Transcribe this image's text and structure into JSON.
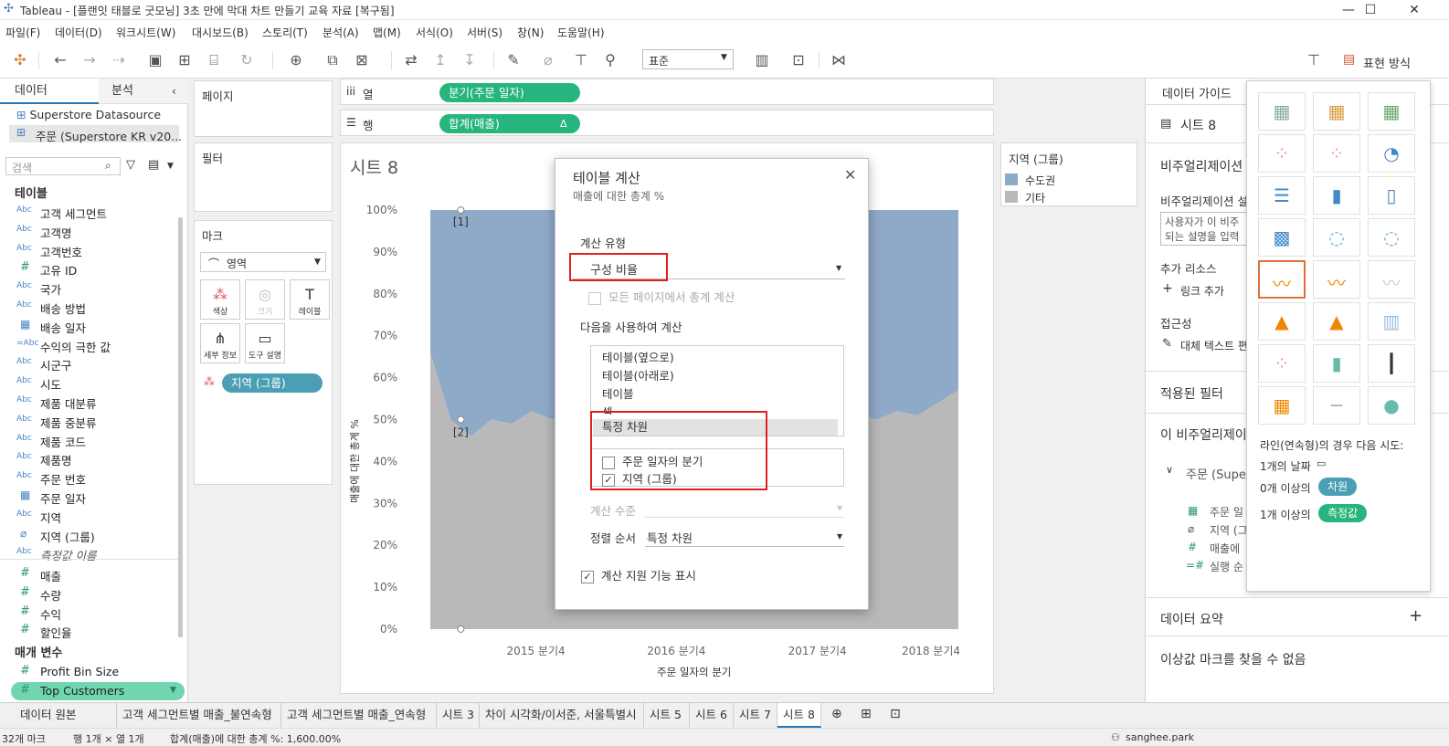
{
  "window": {
    "title": "Tableau - [플랜잇 태블로 굿모닝] 3초 만에 막대 차트 만들기 교육 자료 [복구됨]",
    "controls": [
      "—",
      "☐",
      "✕"
    ]
  },
  "menu": [
    "파일(F)",
    "데이터(D)",
    "워크시트(W)",
    "대시보드(B)",
    "스토리(T)",
    "분석(A)",
    "맵(M)",
    "서식(O)",
    "서버(S)",
    "창(N)",
    "도움말(H)"
  ],
  "toolbar": {
    "fit_select": "표준",
    "show_me_label": "표현 방식"
  },
  "left_pane": {
    "tab_data": "데이터",
    "tab_analysis": "분석",
    "datasources": [
      "Superstore Datasource",
      "주문 (Superstore KR v20..."
    ],
    "search_placeholder": "검색",
    "tables_header": "테이블",
    "fields": [
      {
        "type": "Abc",
        "name": "고객 세그먼트"
      },
      {
        "type": "Abc",
        "name": "고객명"
      },
      {
        "type": "Abc",
        "name": "고객번호"
      },
      {
        "type": "#",
        "name": "고유 ID"
      },
      {
        "type": "Abc",
        "name": "국가"
      },
      {
        "type": "Abc",
        "name": "배송 방법"
      },
      {
        "type": "date",
        "name": "배송 일자"
      },
      {
        "type": "=Abc",
        "name": "수익의 극한 값"
      },
      {
        "type": "Abc",
        "name": "시군구"
      },
      {
        "type": "Abc",
        "name": "시도"
      },
      {
        "type": "Abc",
        "name": "제품 대분류"
      },
      {
        "type": "Abc",
        "name": "제품 중분류"
      },
      {
        "type": "Abc",
        "name": "제품 코드"
      },
      {
        "type": "Abc",
        "name": "제품명"
      },
      {
        "type": "Abc",
        "name": "주문 번호"
      },
      {
        "type": "date",
        "name": "주문 일자"
      },
      {
        "type": "Abc",
        "name": "지역"
      },
      {
        "type": "clip",
        "name": "지역 (그룹)"
      },
      {
        "type": "Abc",
        "name": "측정값 이름"
      }
    ],
    "measures": [
      "매출",
      "수량",
      "수익",
      "할인율"
    ],
    "params_header": "매개 변수",
    "params": [
      "Profit Bin Size",
      "Top Customers"
    ]
  },
  "shelves": {
    "pages": "페이지",
    "columns_label": "열",
    "rows_label": "행",
    "columns_pill": "분기(주문 일자)",
    "rows_pill": "합계(매출)",
    "filters": "필터",
    "marks": "마크",
    "mark_type": "영역",
    "mark_buttons": [
      "색상",
      "크기",
      "레이블",
      "세부 정보",
      "도구 설명"
    ],
    "color_pill": "지역 (그룹)"
  },
  "sheet": {
    "title": "시트 8",
    "y_axis_label": "매출에 대한 총계 %",
    "x_axis_label": "주문 일자의 분기",
    "annotations": [
      "[1]",
      "[2]"
    ]
  },
  "chart_data": {
    "type": "area",
    "x_tick_labels": [
      "2015 분기4",
      "2016 분기4",
      "2017 분기4",
      "2018 분기4"
    ],
    "y_tick_labels": [
      "100%",
      "90%",
      "80%",
      "70%",
      "60%",
      "50%",
      "40%",
      "30%",
      "20%",
      "10%",
      "0%"
    ],
    "ylim": [
      0,
      100
    ],
    "series": [
      {
        "name": "기타",
        "color": "#b9b9b9",
        "values": [
          66,
          50,
          46,
          50,
          49,
          52,
          50,
          52,
          50,
          50,
          50,
          51,
          48,
          50,
          51,
          53,
          49,
          52,
          50,
          52,
          49,
          51,
          50,
          52,
          51,
          54,
          57
        ]
      },
      {
        "name": "수도권",
        "color": "#8fa9c8",
        "values": [
          34,
          50,
          54,
          50,
          51,
          48,
          50,
          48,
          50,
          50,
          50,
          49,
          52,
          50,
          49,
          47,
          51,
          48,
          50,
          48,
          51,
          49,
          50,
          48,
          49,
          46,
          43
        ]
      }
    ]
  },
  "legend": {
    "title": "지역 (그룹)",
    "items": [
      {
        "name": "수도권",
        "color": "#8fa9c8"
      },
      {
        "name": "기타",
        "color": "#b9b9b9"
      }
    ]
  },
  "dialog": {
    "title": "테이블 계산",
    "subtitle": "매출에 대한 총계 %",
    "calc_type_label": "계산 유형",
    "calc_type_value": "구성 비율",
    "all_pages_label": "모든 페이지에서 총계 계산",
    "compute_using_label": "다음을 사용하여 계산",
    "compute_options": [
      "테이블(옆으로)",
      "테이블(아래로)",
      "테이블",
      "셀",
      "특정 차원"
    ],
    "dimensions": [
      {
        "label": "주문 일자의 분기",
        "checked": false
      },
      {
        "label": "지역 (그룹)",
        "checked": true
      }
    ],
    "level_label": "계산 수준",
    "sort_label": "정렬 순서",
    "sort_value": "특정 차원",
    "assist_label": "계산 지원 기능 표시"
  },
  "guide": {
    "title": "데이터 가이드",
    "sheet": "시트 8",
    "viz_desc_header": "비주얼리제이션",
    "viz_desc_sub": "비주얼리제이션 설",
    "desc_placeholder": "사용자가 이 비주\n되는 설명을 입력",
    "resources": "추가 리소스",
    "add_link": "링크 추가",
    "accessibility": "접근성",
    "alt_text": "대체 텍스트 편",
    "applied_filters": "적용된 필터",
    "this_viz": "이 비주얼리제이",
    "source_item": "주문 (Supe",
    "fields": [
      "주문 일",
      "지역 (그",
      "매출에",
      "실행 순"
    ],
    "data_summary": "데이터 요약",
    "no_outliers": "이상값 마크를 찾을 수 없음"
  },
  "showme": {
    "hint_title": "라인(연속형)의 경우 다음 시도:",
    "hint1": "1개의 날짜",
    "hint2_pre": "0개 이상의",
    "hint2_pill": "차원",
    "hint3_pre": "1개 이상의",
    "hint3_pill": "측정값"
  },
  "bottom_tabs": [
    "데이터 원본",
    "고객 세그먼트별 매출_불연속형",
    "고객 세그먼트별 매출_연속형",
    "시트 3",
    "차이 시각화/이서준, 서울특별시",
    "시트 5",
    "시트 6",
    "시트 7",
    "시트 8"
  ],
  "status": {
    "marks": "32개 마크",
    "rows": "행 1개 × 열 1개",
    "sum": "합계(매출)에 대한 총계 %: 1,600.00%",
    "user": "sanghee.park"
  }
}
